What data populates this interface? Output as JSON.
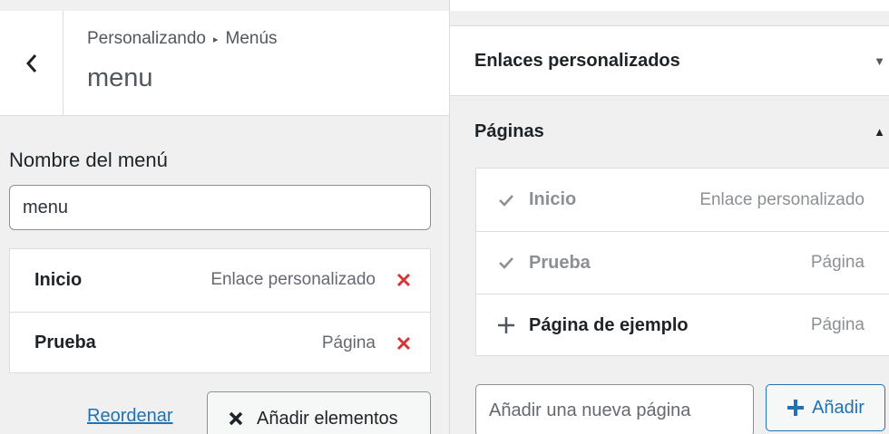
{
  "header": {
    "breadcrumb_root": "Personalizando",
    "breadcrumb_separator": "▸",
    "breadcrumb_current": "Menús",
    "title": "menu"
  },
  "menu_name": {
    "label": "Nombre del menú",
    "value": "menu"
  },
  "menu_items": [
    {
      "title": "Inicio",
      "type": "Enlace personalizado"
    },
    {
      "title": "Prueba",
      "type": "Página"
    }
  ],
  "actions": {
    "reorder_label": "Reordenar",
    "add_items_label": "Añadir elementos"
  },
  "sections": {
    "custom_links_title": "Enlaces personalizados",
    "pages_title": "Páginas"
  },
  "pages": [
    {
      "title": "Inicio",
      "type": "Enlace personalizado",
      "state": "added"
    },
    {
      "title": "Prueba",
      "type": "Página",
      "state": "added"
    },
    {
      "title": "Página de ejemplo",
      "type": "Página",
      "state": "available"
    }
  ],
  "new_page": {
    "placeholder": "Añadir una nueva página",
    "add_label": "Añadir"
  },
  "colors": {
    "accent": "#2271b1",
    "remove": "#d63638",
    "panel_bg": "#f0f0f1"
  }
}
